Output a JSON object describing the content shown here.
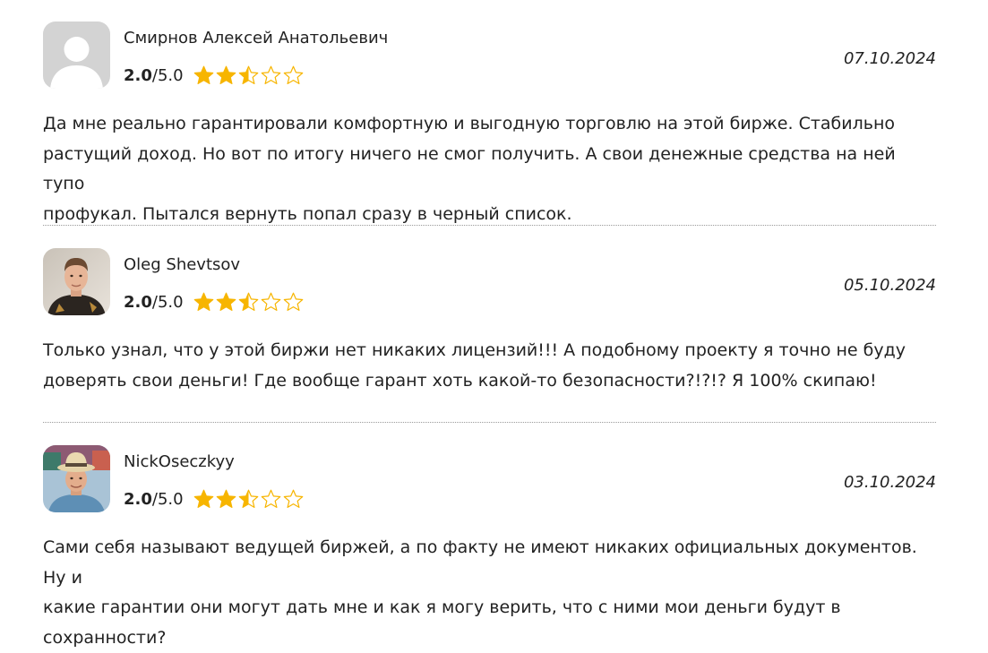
{
  "reviews": [
    {
      "name": "Смирнов Алексей Анатольевич",
      "score": "2.0",
      "separator": "/",
      "max": "5.0",
      "rating": 2.5,
      "date": "07.10.2024",
      "avatar": "default-avatar-icon",
      "lines": [
        "Да мне реально гарантировали комфортную и выгодную торговлю на этой бирже. Стабильно",
        "растущий доход. Но вот по итогу ничего не смог получить. А свои денежные средства на ней тупо",
        "профукал. Пытался вернуть попал сразу в черный список."
      ]
    },
    {
      "name": "Oleg Shevtsov",
      "score": "2.0",
      "separator": "/",
      "max": "5.0",
      "rating": 2.5,
      "date": "05.10.2024",
      "avatar": "user-photo",
      "lines": [
        "Только узнал, что у этой биржи нет никаких лицензий!!! А подобному проекту я точно не буду",
        "доверять свои деньги! Где вообще гарант хоть какой-то безопасности?!?!? Я 100% скипаю!"
      ]
    },
    {
      "name": "NickOseczkyy",
      "score": "2.0",
      "separator": "/",
      "max": "5.0",
      "rating": 2.5,
      "date": "03.10.2024",
      "avatar": "user-photo",
      "lines": [
        "Сами себя называют ведущей биржей, а по факту не имеют никаких официальных документов. Ну и",
        "какие гарантии они могут дать мне и как я могу верить, что с ними мои деньги будут в сохранности?"
      ]
    }
  ],
  "colors": {
    "star": "#F7B500",
    "text": "#222222",
    "divider": "#9A9A9A",
    "avatar_default_bg": "#D3D3D3"
  }
}
